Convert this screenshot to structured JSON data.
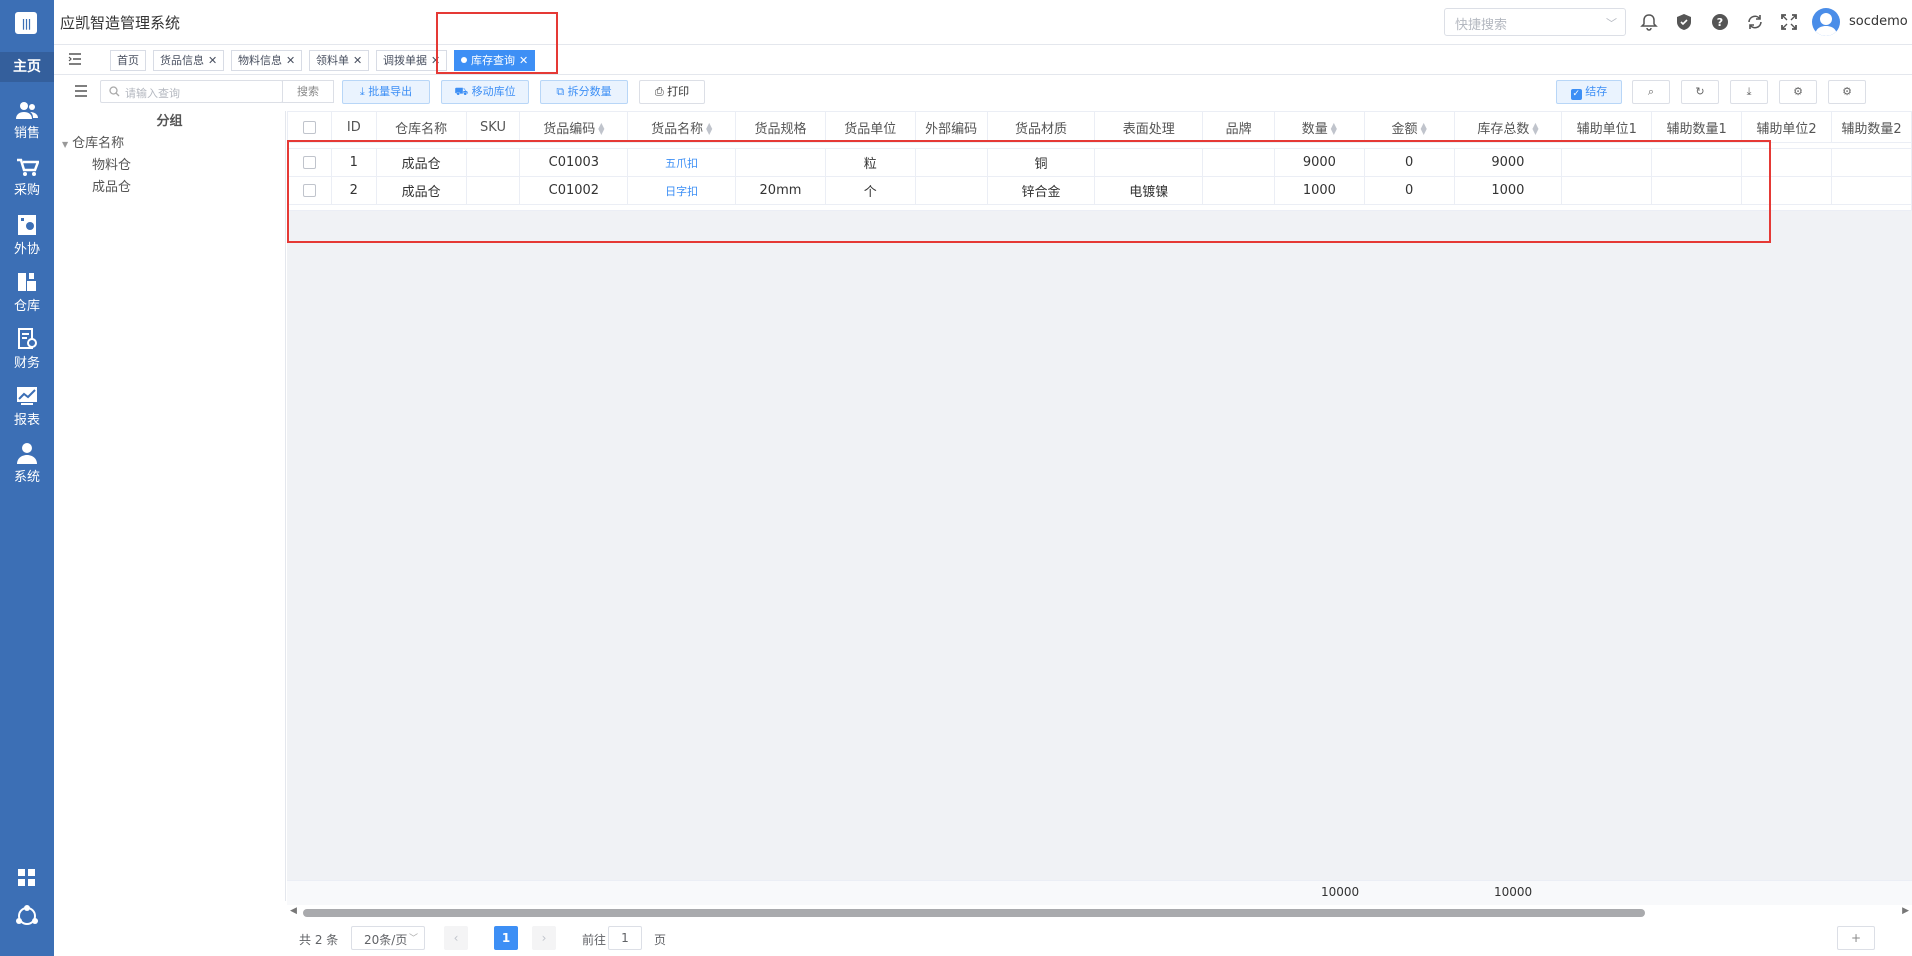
{
  "app": {
    "title": "应凯智造管理系统",
    "quick_search_placeholder": "快捷搜索",
    "username": "socdemo"
  },
  "sidebar": {
    "home": "主页",
    "items": [
      {
        "label": "销售",
        "icon": "users-icon"
      },
      {
        "label": "采购",
        "icon": "cart-icon"
      },
      {
        "label": "外协",
        "icon": "factory-icon"
      },
      {
        "label": "仓库",
        "icon": "warehouse-icon"
      },
      {
        "label": "财务",
        "icon": "finance-icon"
      },
      {
        "label": "报表",
        "icon": "chart-icon"
      },
      {
        "label": "系统",
        "icon": "user-icon"
      }
    ]
  },
  "tabs": [
    {
      "label": "首页",
      "closable": false
    },
    {
      "label": "货品信息",
      "closable": true
    },
    {
      "label": "物料信息",
      "closable": true
    },
    {
      "label": "领料单",
      "closable": true
    },
    {
      "label": "调拨单据",
      "closable": true
    },
    {
      "label": "库存查询",
      "closable": true,
      "active": true
    }
  ],
  "toolbar": {
    "search_placeholder": "请输入查询",
    "search_label": "搜索",
    "batch_export": "批量导出",
    "move_location": "移动库位",
    "split_qty": "拆分数量",
    "print": "打印",
    "stock_toggle": "结存"
  },
  "left_panel": {
    "header": "分组",
    "root": "仓库名称",
    "children": [
      "物料仓",
      "成品仓"
    ]
  },
  "table": {
    "columns": [
      "ID",
      "仓库名称",
      "SKU",
      "货品编码",
      "货品名称",
      "货品规格",
      "货品单位",
      "外部编码",
      "货品材质",
      "表面处理",
      "品牌",
      "数量",
      "金额",
      "库存总数",
      "辅助单位1",
      "辅助数量1",
      "辅助单位2",
      "辅助数量2"
    ],
    "rows": [
      {
        "id": "1",
        "warehouse": "成品仓",
        "sku": "",
        "code": "C01003",
        "name": "五爪扣",
        "spec": "",
        "unit": "粒",
        "ext_code": "",
        "material": "铜",
        "surface": "",
        "brand": "",
        "qty": "9000",
        "amount": "0",
        "total": "9000"
      },
      {
        "id": "2",
        "warehouse": "成品仓",
        "sku": "",
        "code": "C01002",
        "name": "日字扣",
        "spec": "20mm",
        "unit": "个",
        "ext_code": "",
        "material": "锌合金",
        "surface": "电镀镍",
        "brand": "",
        "qty": "1000",
        "amount": "0",
        "total": "1000"
      }
    ],
    "summary": {
      "qty": "10000",
      "total": "10000"
    }
  },
  "pager": {
    "total": "共 2 条",
    "page_size": "20条/页",
    "current_page": "1",
    "goto_prefix": "前往",
    "goto_value": "1",
    "goto_suffix": "页"
  },
  "colors": {
    "sidebar": "#3c6fb5",
    "accent": "#3d8ff5",
    "highlight_box": "#e53935"
  }
}
